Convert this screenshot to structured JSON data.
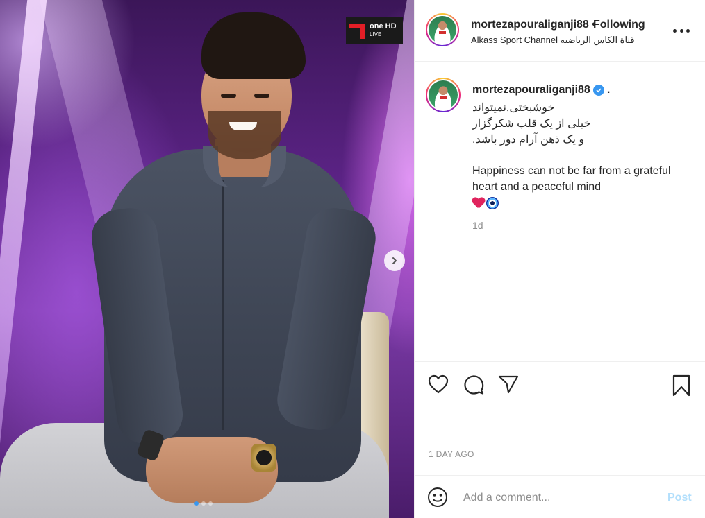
{
  "post": {
    "channel_logo": {
      "brand": "one",
      "quality": "HD",
      "status": "LIVE",
      "accent": "#e31e26"
    },
    "carousel": {
      "slides": 3,
      "active_slide": 1,
      "next_icon": "chevron-right-icon"
    }
  },
  "header": {
    "username": "mortezapouraliganji88",
    "separator": "•",
    "follow_state": "Following",
    "location": "Alkass Sport Channel قناة الكاس الرياضيه",
    "more_icon": "more-horizontal-icon"
  },
  "caption": {
    "username": "mortezapouraliganji88",
    "trailing": ".",
    "verified": true,
    "lines_fa": [
      "خوشبختی,نمیتواند",
      "خیلی از یک قلب شکرگزار",
      "و یک ذهن آرام دور باشد."
    ],
    "lines_en": [
      "Happiness can not be far from a grateful heart and a peaceful mind"
    ],
    "emojis": [
      "red-heart",
      "nazar-amulet"
    ],
    "time": "1d"
  },
  "actions": {
    "like_icon": "heart-icon",
    "comment_icon": "comment-icon",
    "share_icon": "paper-plane-icon",
    "save_icon": "bookmark-icon"
  },
  "date_label": "1 DAY AGO",
  "comment": {
    "placeholder": "Add a comment...",
    "value": "",
    "post_label": "Post",
    "post_color": "#b2dffc"
  }
}
